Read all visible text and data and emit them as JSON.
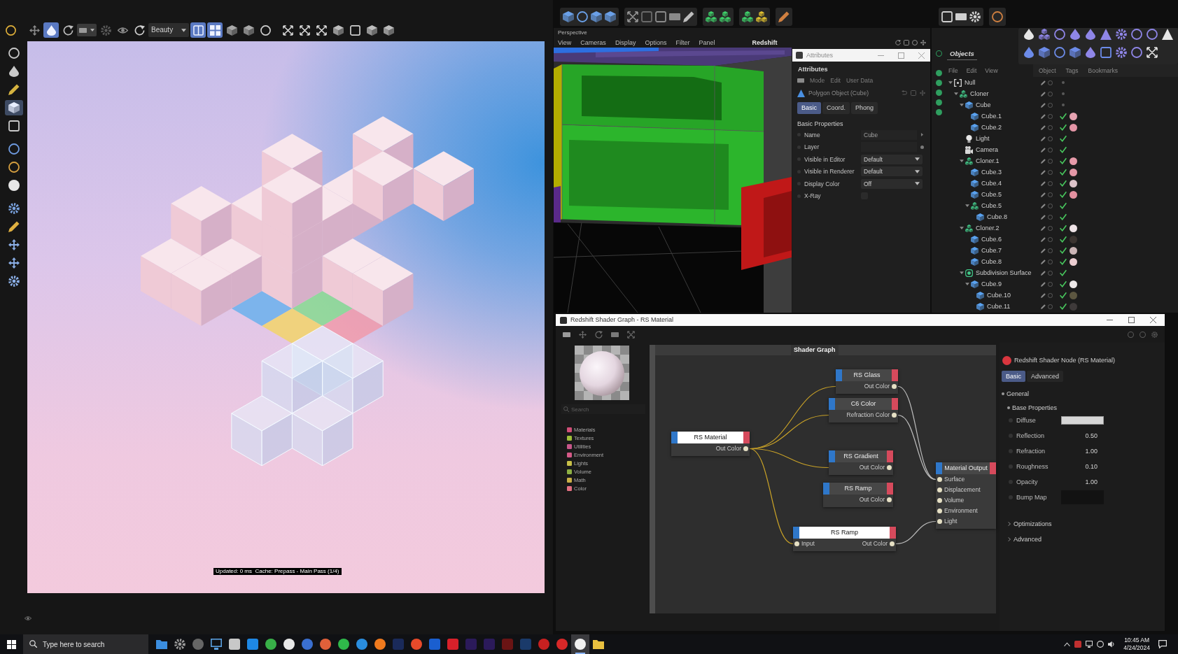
{
  "left_window": {
    "toolbar": [
      {
        "kind": "tool",
        "on": false
      },
      {
        "kind": "tool",
        "on": false
      },
      {
        "kind": "tool",
        "on": true
      },
      {
        "kind": "tool",
        "on": false
      },
      {
        "kind": "picker"
      },
      {
        "kind": "tool",
        "on": false
      },
      {
        "kind": "tool",
        "on": false
      },
      {
        "kind": "tool",
        "on": false
      },
      {
        "kind": "dropdown",
        "value": "Beauty"
      },
      {
        "kind": "tool",
        "on": true
      },
      {
        "kind": "tool",
        "on": true
      },
      {
        "kind": "tool",
        "on": false
      },
      {
        "kind": "tool",
        "on": false
      },
      {
        "kind": "tool",
        "on": false
      },
      {
        "kind": "tool",
        "on": false
      },
      {
        "kind": "tool",
        "on": false
      },
      {
        "kind": "tool",
        "on": false
      },
      {
        "kind": "tool",
        "on": false
      },
      {
        "kind": "tool",
        "on": false
      },
      {
        "kind": "tool",
        "on": false
      },
      {
        "kind": "tool",
        "on": false
      }
    ],
    "sidebar": [
      {
        "on": false
      },
      {
        "on": false
      },
      {
        "on": false
      },
      {
        "on": true
      },
      {
        "on": false
      },
      {
        "on": false
      },
      {
        "on": false
      },
      {
        "on": false
      },
      {
        "on": false
      },
      {
        "on": false
      },
      {
        "on": false
      },
      {
        "on": false
      },
      {
        "on": false
      }
    ],
    "render": {
      "status": "Updated: 0 ms  Cache: Prepass - Main Pass (1/4)"
    }
  },
  "viewport": {
    "label": "Perspective",
    "menu": [
      "View",
      "Cameras",
      "Display",
      "Options",
      "Filter",
      "Panel"
    ],
    "renderer": "Redshift"
  },
  "attributes": {
    "title": "Attributes",
    "heading": "Attributes",
    "menu": [
      "Mode",
      "Edit",
      "User Data"
    ],
    "object": "Polygon Object (Cube)",
    "tabs": [
      {
        "label": "Basic",
        "selected": true
      },
      {
        "label": "Coord.",
        "selected": false
      },
      {
        "label": "Phong",
        "selected": false
      }
    ],
    "section": "Basic Properties",
    "fields": [
      {
        "kind": "text",
        "label": "Name",
        "value": "Cube"
      },
      {
        "kind": "text",
        "label": "Layer"
      },
      {
        "kind": "select",
        "label": "Visible in Editor",
        "value": "Default"
      },
      {
        "kind": "select",
        "label": "Visible in Renderer",
        "value": "Default"
      },
      {
        "kind": "select",
        "label": "Display Color",
        "value": "Off"
      },
      {
        "kind": "checkbox",
        "label": "X-Ray",
        "checked": false
      }
    ]
  },
  "objects": {
    "tab": "Objects",
    "menu_left": [
      "File",
      "Edit",
      "View"
    ],
    "menu_right": [
      "Object",
      "Tags",
      "Bookmarks"
    ],
    "tree": [
      {
        "name": "Null",
        "kind": "null",
        "checked": false,
        "expanded": true,
        "children": [
          {
            "name": "Cloner",
            "kind": "cloner",
            "checked": false,
            "expanded": true,
            "children": [
              {
                "name": "Cube",
                "kind": "cube",
                "checked": false,
                "expanded": true,
                "children": [
                  {
                    "name": "Cube.1",
                    "kind": "cube",
                    "checked": true,
                    "color": "#e6a3b1"
                  },
                  {
                    "name": "Cube.2",
                    "kind": "cube",
                    "checked": true,
                    "color": "#e495a6"
                  }
                ]
              },
              {
                "name": "Light",
                "kind": "light",
                "checked": true
              },
              {
                "name": "Camera",
                "kind": "camera",
                "checked": true
              },
              {
                "name": "Cloner.1",
                "kind": "cloner",
                "checked": true,
                "color": "#e69aa9",
                "expanded": true,
                "children": [
                  {
                    "name": "Cube.3",
                    "kind": "cube",
                    "checked": true,
                    "color": "#e498a7"
                  },
                  {
                    "name": "Cube.4",
                    "kind": "cube",
                    "checked": true,
                    "color": "#dcc3c9"
                  },
                  {
                    "name": "Cube.5",
                    "kind": "cube",
                    "checked": true,
                    "color": "#e3909f"
                  },
                  {
                    "name": "Cube.5",
                    "kind": "cloner",
                    "checked": true,
                    "expanded": true,
                    "children": [
                      {
                        "name": "Cube.8",
                        "kind": "cube",
                        "checked": true
                      }
                    ]
                  }
                ]
              },
              {
                "name": "Cloner.2",
                "kind": "cloner",
                "checked": true,
                "color": "#eee3e6",
                "expanded": true,
                "children": [
                  {
                    "name": "Cube.6",
                    "kind": "cube",
                    "checked": true,
                    "color": "#3b3430"
                  },
                  {
                    "name": "Cube.7",
                    "kind": "cube",
                    "checked": true,
                    "color": "#cbb5b6"
                  },
                  {
                    "name": "Cube.8",
                    "kind": "cube",
                    "checked": true,
                    "color": "#ebcdd1"
                  }
                ]
              },
              {
                "name": "Subdivision Surface",
                "kind": "subdivision",
                "checked": true,
                "expanded": true,
                "children": [
                  {
                    "name": "Cube.9",
                    "kind": "cube",
                    "checked": true,
                    "color": "#ede8e8",
                    "expanded": true,
                    "children": [
                      {
                        "name": "Cube.10",
                        "kind": "cube",
                        "checked": true,
                        "color": "#5c5640"
                      },
                      {
                        "name": "Cube.11",
                        "kind": "cube",
                        "checked": true,
                        "color": "#3e3a3a"
                      }
                    ]
                  }
                ]
              }
            ]
          }
        ]
      }
    ]
  },
  "shader_graph": {
    "title": "Redshift Shader Graph - RS Material",
    "search": {
      "placeholder": "Search"
    },
    "categories": [
      {
        "label": "Materials",
        "color": "#d24f78"
      },
      {
        "label": "Textures",
        "color": "#9fbf3a"
      },
      {
        "label": "Utilities",
        "color": "#c8578a"
      },
      {
        "label": "Environment",
        "color": "#d65a88"
      },
      {
        "label": "Lights",
        "color": "#c8c048"
      },
      {
        "label": "Volume",
        "color": "#8db043"
      },
      {
        "label": "Math",
        "color": "#c9b046"
      },
      {
        "label": "Color",
        "color": "#e26f80"
      }
    ],
    "tab": "Shader Graph",
    "nodes": [
      {
        "title": "RS Glass",
        "selected": false,
        "rows": [
          {
            "out": "Out Color"
          }
        ]
      },
      {
        "title": "C6 Color",
        "selected": false,
        "rows": [
          {
            "out": "Refraction Color"
          }
        ]
      },
      {
        "title": "RS Material",
        "selected": true,
        "rows": [
          {
            "out": "Out Color"
          }
        ]
      },
      {
        "title": "RS Gradient",
        "selected": false,
        "rows": [
          {
            "out": "Out Color"
          }
        ]
      },
      {
        "title": "RS Ramp",
        "selected": false,
        "rows": [
          {
            "out": "Out Color"
          }
        ]
      },
      {
        "title": "RS Ramp",
        "selected": true,
        "rows": [
          {
            "in": "Input",
            "out": "Out Color"
          }
        ]
      },
      {
        "title": "Material Output",
        "selected": false,
        "rows": [
          {
            "in": "Surface"
          },
          {
            "in": "Displacement"
          },
          {
            "in": "Volume"
          },
          {
            "in": "Environment"
          },
          {
            "in": "Light"
          }
        ]
      }
    ],
    "properties": {
      "title": "Redshift Shader Node (RS Material)",
      "tabs": [
        {
          "label": "Basic",
          "selected": true
        },
        {
          "label": "Advanced",
          "selected": false
        }
      ],
      "sections": [
        {
          "label": "General",
          "expanded": true,
          "children": [
            {
              "label": "Base Properties",
              "expanded": true,
              "fields": [
                {
                  "kind": "color",
                  "label": "Diffuse",
                  "color": "#d6d6d6"
                },
                {
                  "kind": "number",
                  "label": "Reflection",
                  "value": "0.50"
                },
                {
                  "kind": "number",
                  "label": "Refraction",
                  "value": "1.00"
                },
                {
                  "kind": "number",
                  "label": "Roughness",
                  "value": "0.10"
                },
                {
                  "kind": "number",
                  "label": "Opacity",
                  "value": "1.00"
                },
                {
                  "kind": "texture",
                  "label": "Bump Map"
                }
              ]
            },
            {
              "label": "Optimizations",
              "expanded": false
            },
            {
              "label": "Advanced",
              "expanded": false
            }
          ]
        }
      ]
    }
  },
  "taskbar": {
    "search": {
      "placeholder": "Type here to search"
    },
    "apps": [
      {
        "selected": false
      },
      {
        "selected": false
      },
      {
        "selected": false
      },
      {
        "selected": false
      },
      {
        "selected": false
      },
      {
        "selected": false
      },
      {
        "selected": false
      },
      {
        "selected": false
      },
      {
        "selected": false
      },
      {
        "selected": false
      },
      {
        "selected": false
      },
      {
        "selected": false
      },
      {
        "selected": false
      },
      {
        "selected": false
      },
      {
        "selected": false
      },
      {
        "selected": false
      },
      {
        "selected": false
      },
      {
        "selected": false
      },
      {
        "selected": false
      },
      {
        "selected": false
      },
      {
        "selected": false
      },
      {
        "selected": false
      },
      {
        "selected": false
      },
      {
        "selected": true
      },
      {
        "selected": false
      }
    ],
    "clock": {
      "time": "10:45 AM",
      "date": "4/24/2024"
    }
  }
}
